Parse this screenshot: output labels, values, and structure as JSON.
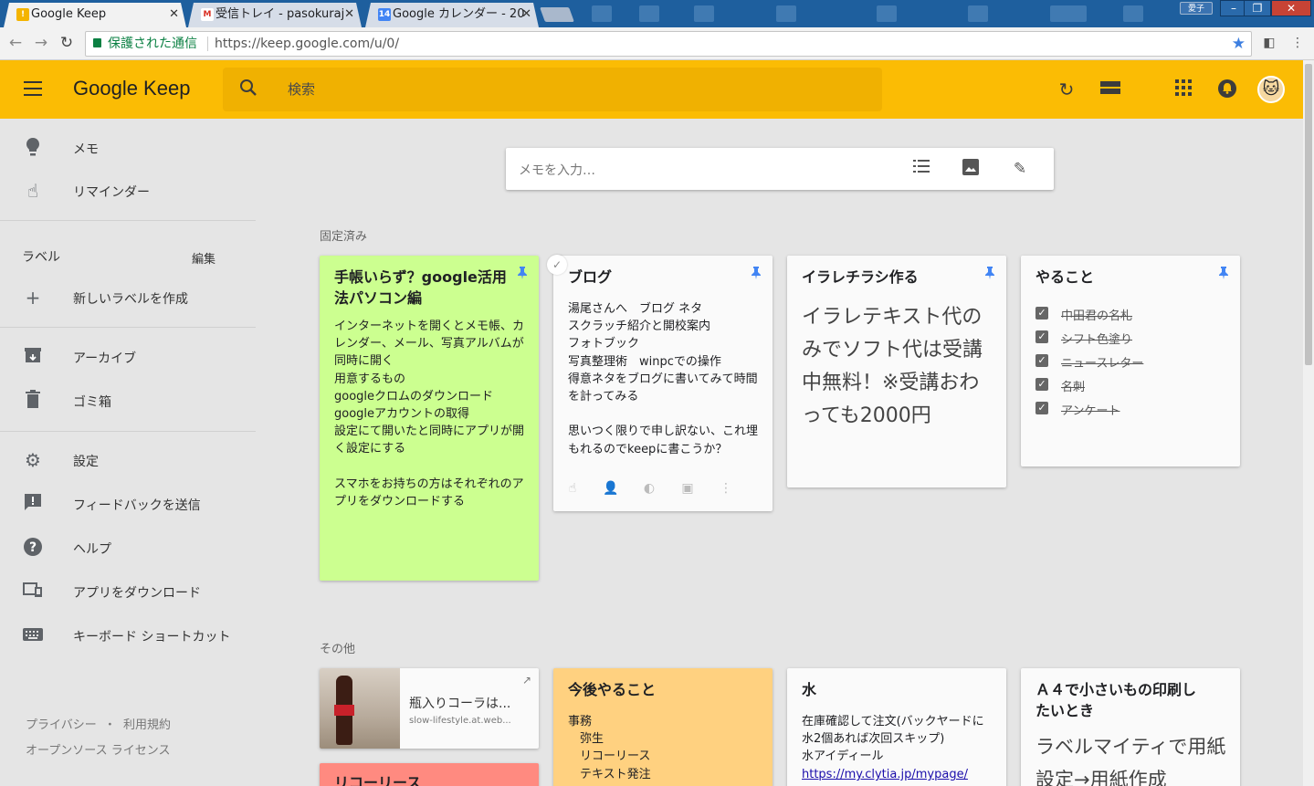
{
  "browser": {
    "tabs": [
      {
        "title": "Google Keep",
        "favicon": "keep-icon",
        "active": true
      },
      {
        "title": "受信トレイ - pasokuraj",
        "favicon": "gmail-icon",
        "active": false
      },
      {
        "title": "Google カレンダー - 20",
        "favicon": "calendar-icon",
        "active": false
      }
    ],
    "user_chip": "愛子",
    "secure_label": "保護された通信",
    "url": "https://keep.google.com/u/0/",
    "calendar_badge": "14"
  },
  "header": {
    "logo_text": "Google Keep",
    "search_placeholder": "検索"
  },
  "sidebar": {
    "items_top": [
      {
        "label": "メモ",
        "icon": "bulb-icon"
      },
      {
        "label": "リマインダー",
        "icon": "reminder-hand-icon"
      }
    ],
    "labels_title": "ラベル",
    "labels_edit": "編集",
    "new_label": "新しいラベルを作成",
    "items_mid": [
      {
        "label": "アーカイブ",
        "icon": "archive-icon"
      },
      {
        "label": "ゴミ箱",
        "icon": "trash-icon"
      }
    ],
    "items_bottom": [
      {
        "label": "設定",
        "icon": "gear-icon"
      },
      {
        "label": "フィードバックを送信",
        "icon": "feedback-icon"
      },
      {
        "label": "ヘルプ",
        "icon": "help-icon"
      },
      {
        "label": "アプリをダウンロード",
        "icon": "devices-icon"
      },
      {
        "label": "キーボード ショートカット",
        "icon": "keyboard-icon"
      }
    ],
    "footer": {
      "privacy": "プライバシー",
      "dot": "・",
      "terms": "利用規約",
      "oss": "オープンソース ライセンス"
    }
  },
  "composer": {
    "placeholder": "メモを入力…"
  },
  "sections": {
    "pinned": "固定済み",
    "others": "その他"
  },
  "colors": {
    "header": "#fbbc04",
    "note_green": "#ccff90",
    "note_orange": "#ffd180",
    "note_red": "#ff8a80",
    "pin": "#4285f4"
  },
  "pinned_notes": [
    {
      "title": "手帳いらず？google活用法パソコン編",
      "body": "インターネットを開くとメモ帳、カレンダー、メール、写真アルバムが同時に開く\n用意するもの\ngoogleクロムのダウンロード\ngoogleアカウントの取得\n設定にて開いたと同時にアプリが開く設定にする\n\nスマホをお持ちの方はそれぞれのアプリをダウンロードする"
    },
    {
      "title": "ブログ",
      "body": "湯尾さんへ　ブログ ネタ\nスクラッチ紹介と開校案内\nフォトブック\n写真整理術　winpcでの操作\n得意ネタをブログに書いてみて時間を計ってみる\n\n思いつく限りで申し訳ない、これ埋もれるのでkeepに書こうか？"
    },
    {
      "title": "イラレチラシ作る",
      "body": "イラレテキスト代のみでソフト代は受講中無料！※受講おわっても2000円"
    },
    {
      "title": "やること",
      "checklist": [
        "中田君の名札",
        "シフト色塗り",
        "ニュースレター",
        "名刺",
        "アンケート"
      ]
    }
  ],
  "other_notes": {
    "link_card": {
      "title": "瓶入りコーラは...",
      "domain": "slow-lifestyle.at.web..."
    },
    "red_note_title": "リコーリース",
    "todo": {
      "title": "今後やること",
      "body": "事務\n　弥生\n　リコーリース\n　テキスト発注"
    },
    "water": {
      "title": "水",
      "body": "在庫確認して注文(バックヤードに水2個あれば次回スキップ)\n水アイディール",
      "link": "https://my.clytia.jp/mypage/"
    },
    "a4": {
      "title": "Ａ４で小さいもの印刷したいとき",
      "body": "ラベルマイティで用紙設定→用紙作成"
    }
  }
}
